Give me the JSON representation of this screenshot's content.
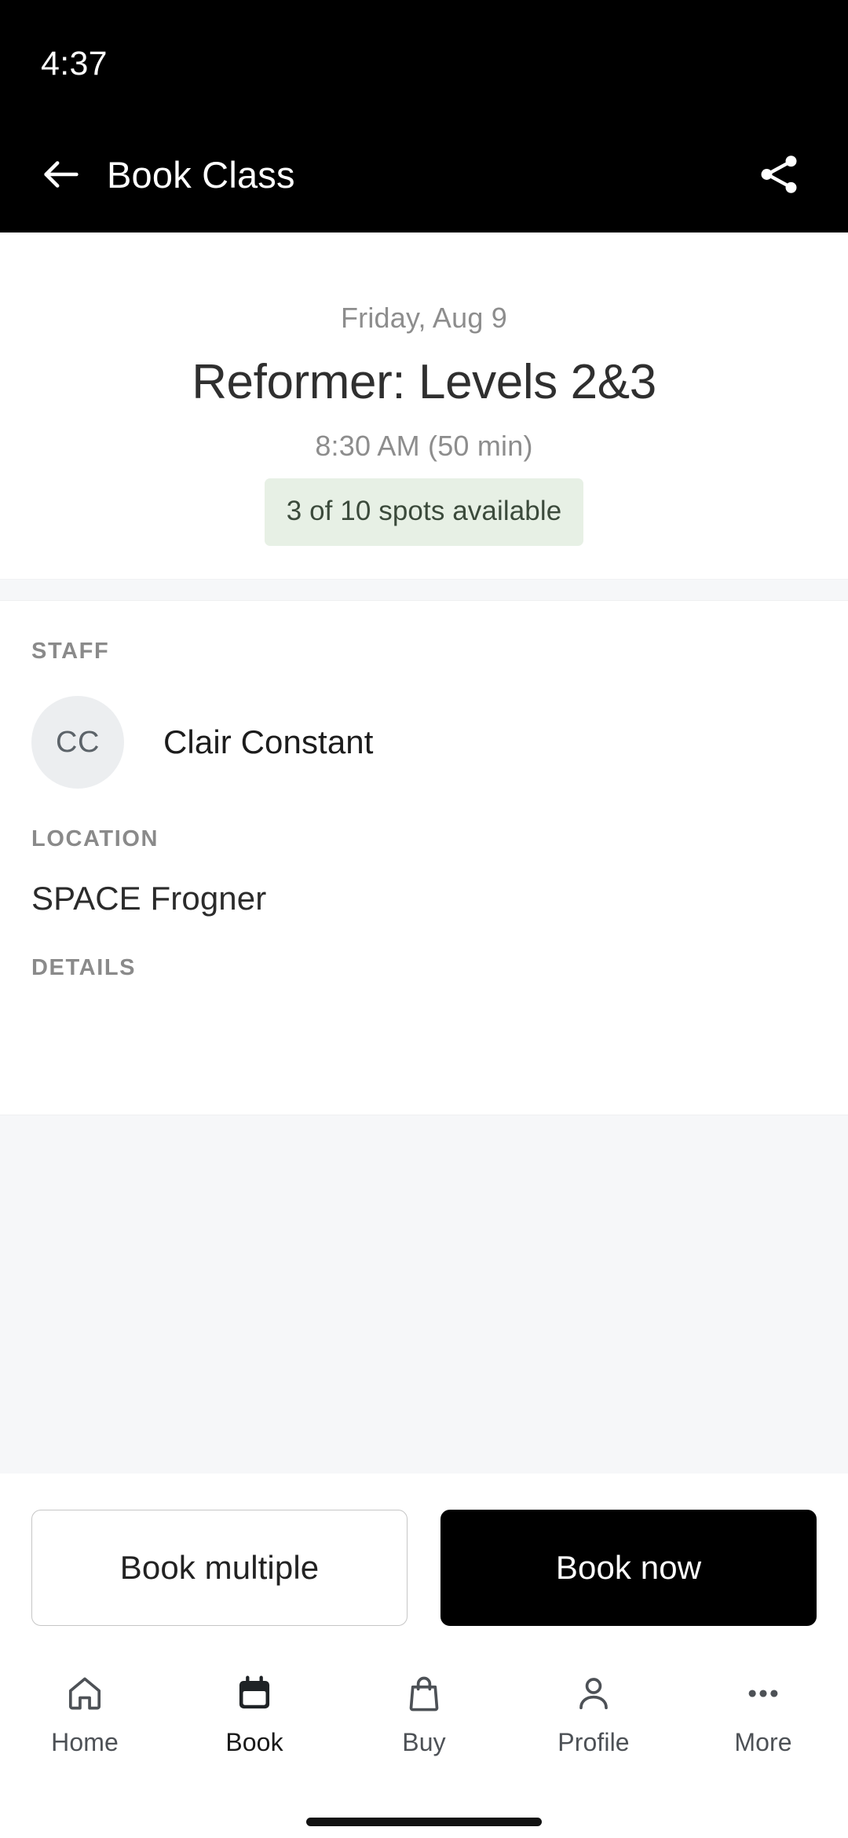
{
  "status_bar": {
    "clock": "4:37"
  },
  "app_bar": {
    "title": "Book Class",
    "back_icon": "arrow-left-icon",
    "share_icon": "share-icon"
  },
  "class_summary": {
    "date": "Friday, Aug 9",
    "title": "Reformer: Levels 2&3",
    "time": "8:30 AM (50 min)",
    "spots_badge": "3 of 10 spots available",
    "spots_badge_bg": "#e7f0e5",
    "spots_badge_color": "#3b4a3b"
  },
  "sections": {
    "staff_label": "STAFF",
    "staff": {
      "initials": "CC",
      "name": "Clair Constant"
    },
    "location_label": "LOCATION",
    "location_value": "SPACE Frogner",
    "details_label": "DETAILS",
    "details_value": ""
  },
  "actions": {
    "secondary_label": "Book multiple",
    "primary_label": "Book now",
    "primary_bg": "#000000"
  },
  "bottom_nav": {
    "items": [
      {
        "label": "Home",
        "icon": "home-icon",
        "active": false
      },
      {
        "label": "Book",
        "icon": "calendar-icon",
        "active": true
      },
      {
        "label": "Buy",
        "icon": "shopping-bag-icon",
        "active": false
      },
      {
        "label": "Profile",
        "icon": "person-icon",
        "active": false
      },
      {
        "label": "More",
        "icon": "ellipsis-icon",
        "active": false
      }
    ]
  }
}
